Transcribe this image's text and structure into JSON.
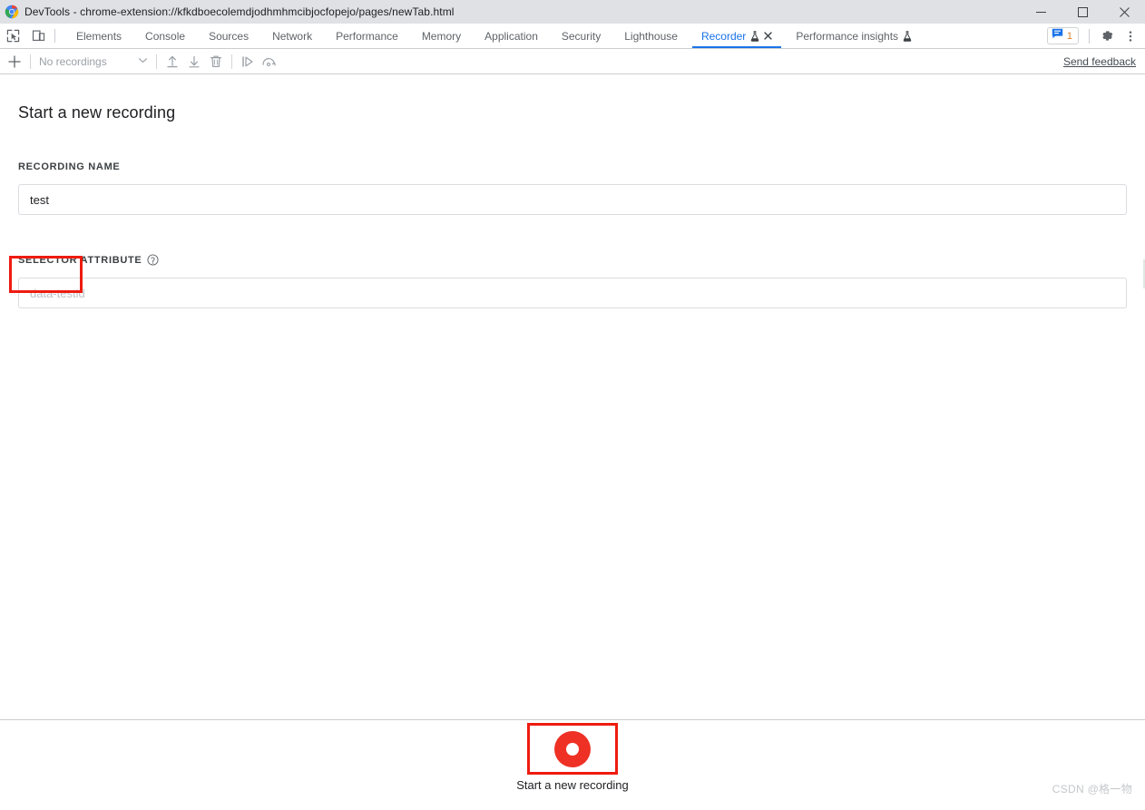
{
  "window": {
    "title": "DevTools - chrome-extension://kfkdboecolemdjodhmhmcibjocfopejo/pages/newTab.html",
    "favicon_name": "chrome-logo-icon",
    "controls": [
      {
        "name": "minimize-button",
        "glyph": "minimize"
      },
      {
        "name": "maximize-button",
        "glyph": "maximize"
      },
      {
        "name": "close-button",
        "glyph": "close"
      }
    ]
  },
  "devtools": {
    "inspect_icon": "inspect-element-icon",
    "device_toolbar_icon": "device-toolbar-icon",
    "tabs": [
      {
        "label": "Elements",
        "active": false,
        "flask": false,
        "closable": false
      },
      {
        "label": "Console",
        "active": false,
        "flask": false,
        "closable": false
      },
      {
        "label": "Sources",
        "active": false,
        "flask": false,
        "closable": false
      },
      {
        "label": "Network",
        "active": false,
        "flask": false,
        "closable": false
      },
      {
        "label": "Performance",
        "active": false,
        "flask": false,
        "closable": false
      },
      {
        "label": "Memory",
        "active": false,
        "flask": false,
        "closable": false
      },
      {
        "label": "Application",
        "active": false,
        "flask": false,
        "closable": false
      },
      {
        "label": "Security",
        "active": false,
        "flask": false,
        "closable": false
      },
      {
        "label": "Lighthouse",
        "active": false,
        "flask": false,
        "closable": false
      },
      {
        "label": "Recorder",
        "active": true,
        "flask": true,
        "closable": true
      },
      {
        "label": "Performance insights",
        "active": false,
        "flask": true,
        "closable": false
      }
    ],
    "issues_count": "1",
    "issues_icon": "issues-speech-bubble-icon",
    "settings_icon": "gear-icon",
    "more_icon": "more-vertical-icon",
    "accent_color": "#1a73e8",
    "issues_count_color": "#d9822b"
  },
  "recorder_toolbar": {
    "add_icon": "plus-icon",
    "recordings_select_value": "No recordings",
    "select_chevron_icon": "chevron-down-icon",
    "import_icon": "import-upload-icon",
    "export_icon": "export-download-icon",
    "delete_icon": "trash-icon",
    "replay_icon": "replay-step-icon",
    "performance_replay_icon": "measure-replay-icon",
    "send_feedback_label": "Send feedback"
  },
  "dialog": {
    "title": "Start a new recording",
    "close_icon": "close-icon",
    "fields": [
      {
        "label": "RECORDING NAME",
        "value": "test",
        "placeholder": "",
        "has_help": false,
        "highlighted": true
      },
      {
        "label": "SELECTOR ATTRIBUTE",
        "value": "",
        "placeholder": "data-testid",
        "has_help": true,
        "highlighted": false
      }
    ]
  },
  "record_section": {
    "button_name": "start-recording-button",
    "label": "Start a new recording",
    "highlighted": true,
    "record_color": "#ee3124",
    "annotation_color": "#ee1b10"
  },
  "watermark": {
    "text": "CSDN @格一物"
  }
}
